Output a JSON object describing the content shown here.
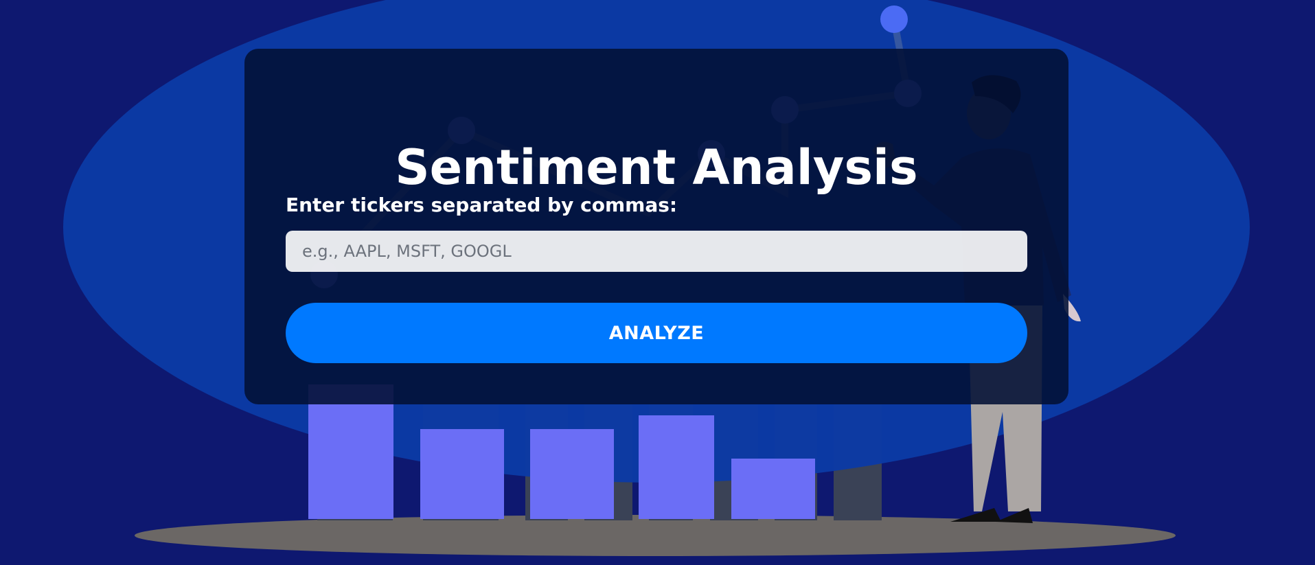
{
  "colors": {
    "background": "#0e1870",
    "ellipse": "#0b3aa6",
    "card": "#021034",
    "button": "#0079ff",
    "button_text": "#ffffff",
    "input_bg": "#e8e9ee",
    "bar_fill": "#6b6ef6",
    "ground": "#6b6765"
  },
  "form": {
    "title": "Sentiment Analysis",
    "label": "Enter tickers separated by commas:",
    "input_value": "",
    "input_placeholder": "e.g., AAPL, MSFT, GOOGL",
    "button_label": "ANALYZE"
  },
  "illustration": {
    "description_icon": "person-presenting-bar-chart-illustration"
  }
}
